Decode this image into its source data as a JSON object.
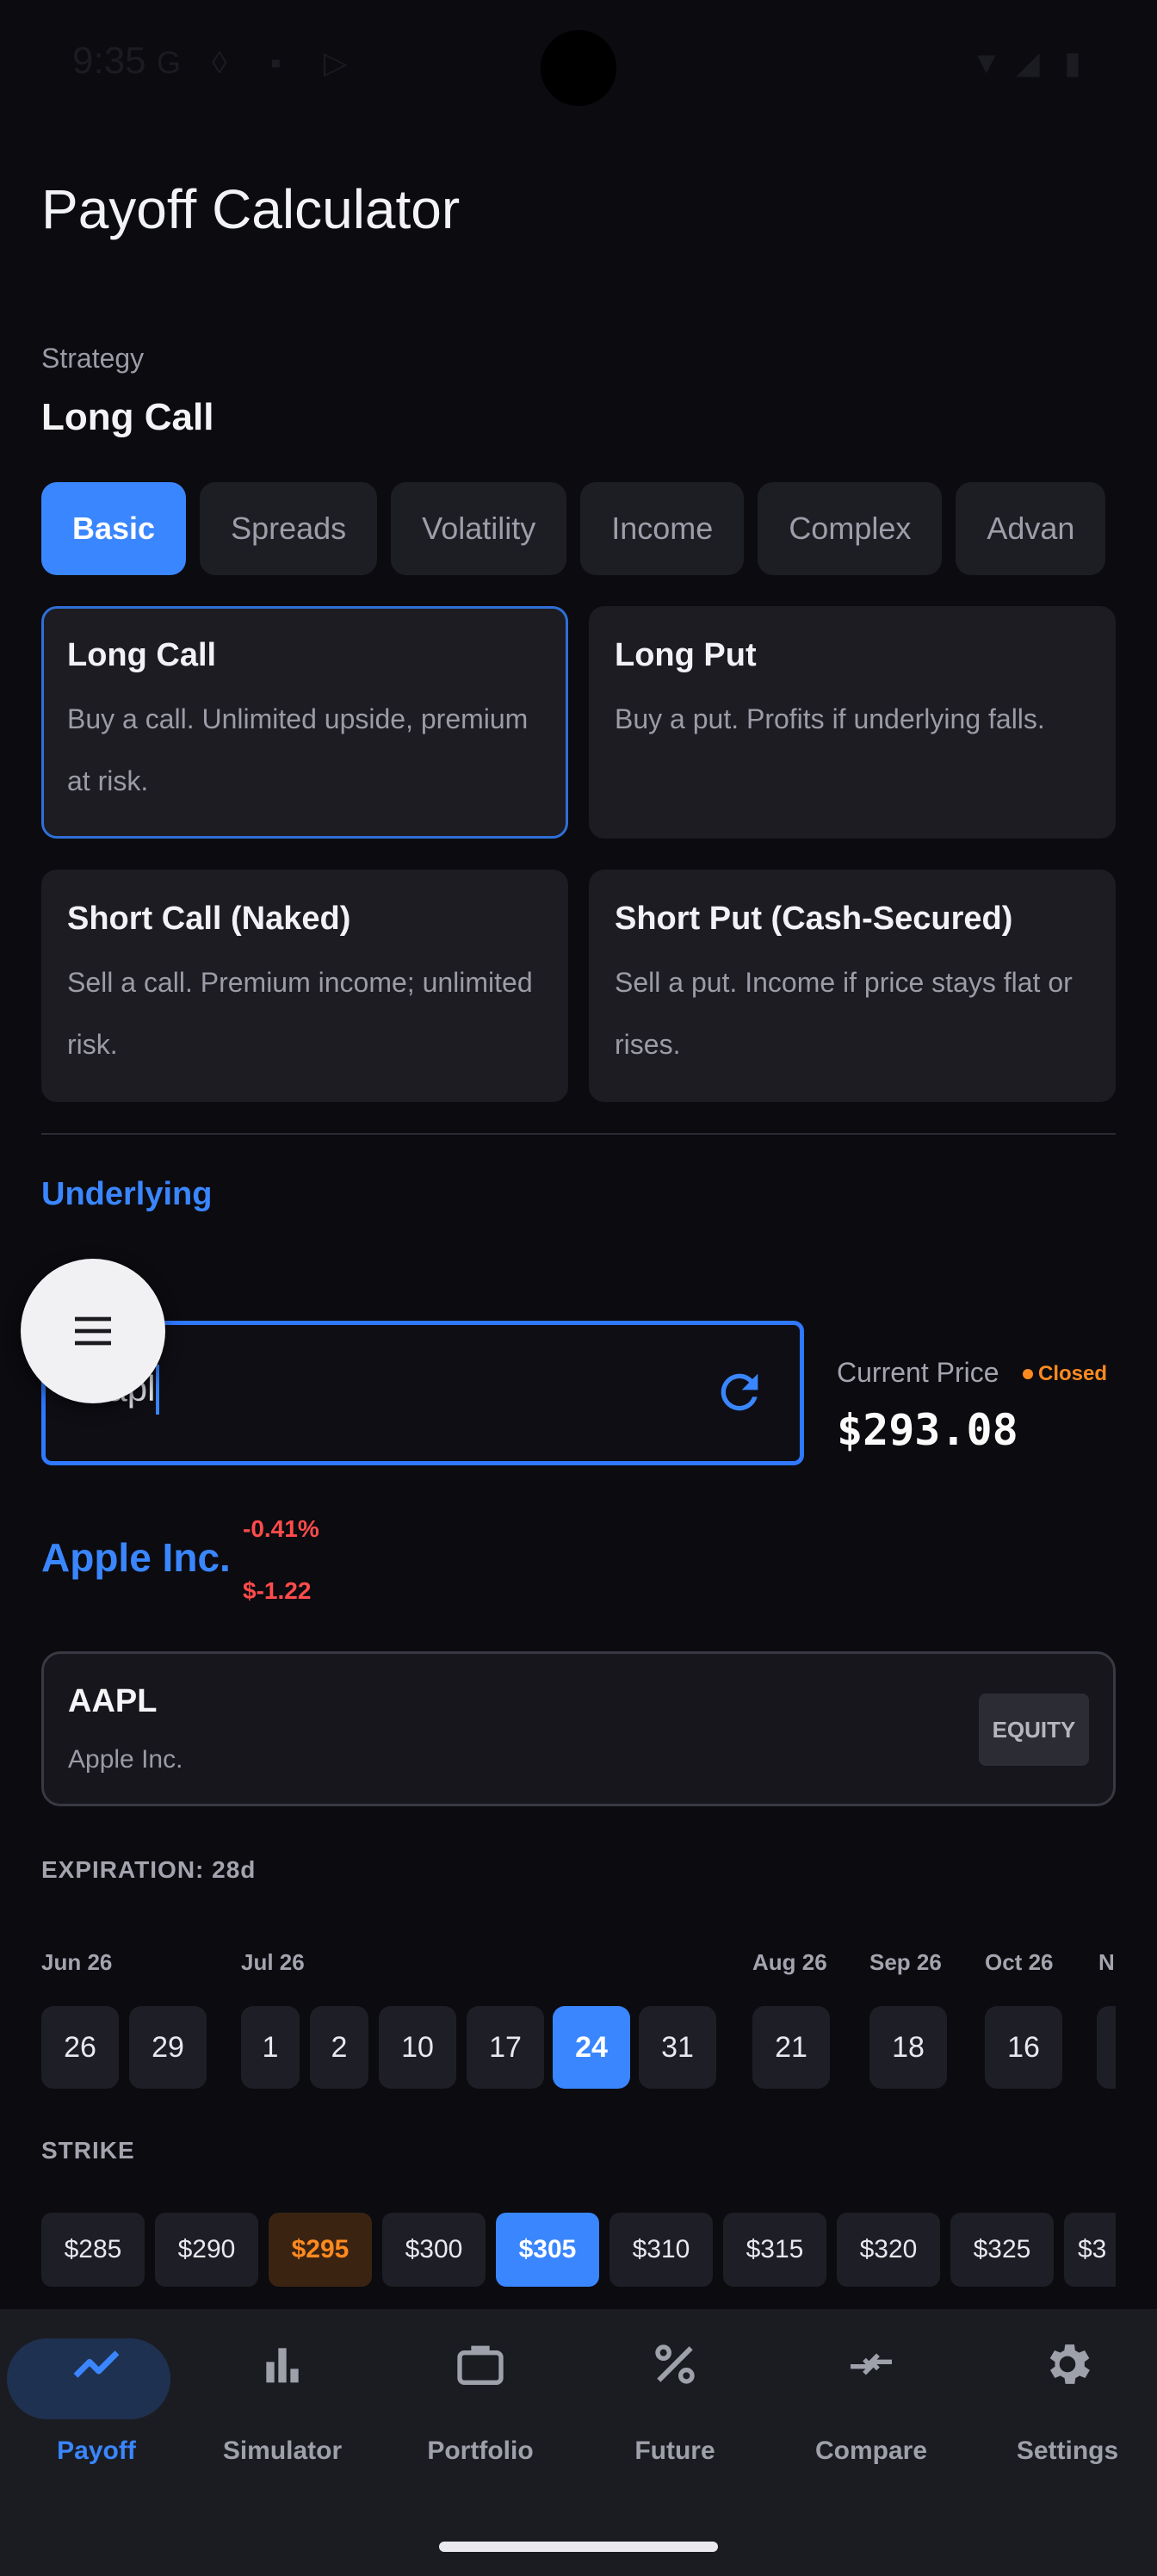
{
  "status": {
    "time": "9:35"
  },
  "header": {
    "title": "Payoff Calculator",
    "strategy_label": "Strategy",
    "strategy_value": "Long Call"
  },
  "tabs": [
    {
      "label": "Basic",
      "active": true
    },
    {
      "label": "Spreads"
    },
    {
      "label": "Volatility"
    },
    {
      "label": "Income"
    },
    {
      "label": "Complex"
    },
    {
      "label": "Advan"
    }
  ],
  "strategies": [
    {
      "title": "Long Call",
      "desc": "Buy a call. Unlimited upside, premium at risk.",
      "selected": true
    },
    {
      "title": "Long Put",
      "desc": "Buy a put. Profits if underlying falls."
    },
    {
      "title": "Short Call (Naked)",
      "desc": "Sell a call. Premium income; unlimited risk."
    },
    {
      "title": "Short Put (Cash-Secured)",
      "desc": "Sell a put. Income if price stays flat or rises."
    }
  ],
  "underlying": {
    "section_title": "Underlying",
    "input_value": "aapl",
    "current_price_label": "Current Price",
    "market_status": "Closed",
    "price": "$293.08",
    "company": "Apple Inc.",
    "change_pct": "-0.41%",
    "change_abs": "$-1.22",
    "symbol": "AAPL",
    "symbol_name": "Apple Inc.",
    "badge": "EQUITY"
  },
  "expiration": {
    "label": "EXPIRATION: 28d",
    "months": [
      "Jun 26",
      "Jul 26",
      "Aug 26",
      "Sep 26",
      "Oct 26",
      "N"
    ],
    "days": [
      "26",
      "29",
      "1",
      "2",
      "10",
      "17",
      "24",
      "31",
      "21",
      "18",
      "16"
    ],
    "selected_day": "24"
  },
  "strike": {
    "label": "STRIKE",
    "values": [
      "$285",
      "$290",
      "$295",
      "$300",
      "$305",
      "$310",
      "$315",
      "$320",
      "$325",
      "$3"
    ],
    "atm": "$295",
    "selected": "$305"
  },
  "nav": [
    {
      "label": "Payoff",
      "icon": "trending-up-icon",
      "active": true
    },
    {
      "label": "Simulator",
      "icon": "bar-chart-icon"
    },
    {
      "label": "Portfolio",
      "icon": "briefcase-icon"
    },
    {
      "label": "Future",
      "icon": "percent-icon"
    },
    {
      "label": "Compare",
      "icon": "compare-arrows-icon"
    },
    {
      "label": "Settings",
      "icon": "gear-icon"
    }
  ],
  "colors": {
    "accent": "#3a86ff",
    "negative": "#ff4b4b",
    "closed": "#ff8a1f",
    "background": "#0b0b10"
  }
}
